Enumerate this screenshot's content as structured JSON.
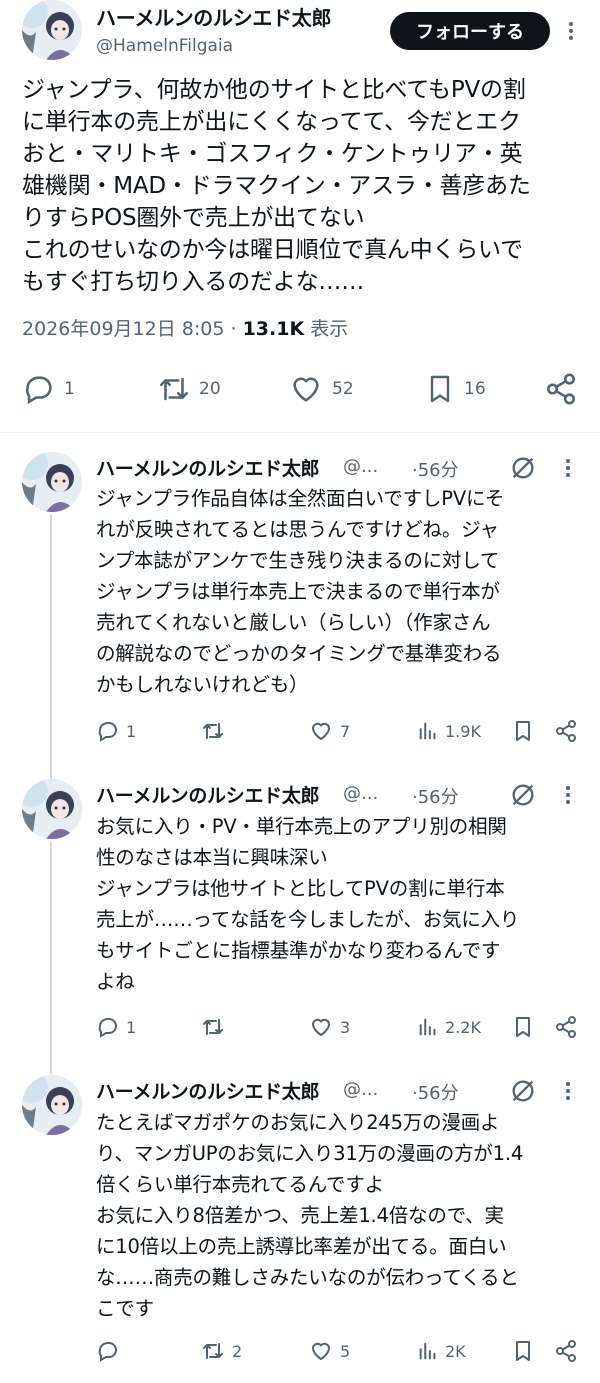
{
  "main_tweet": {
    "display_name": "ハーメルンのルシエド太郎",
    "handle": "@HamelnFilgaia",
    "follow_label": "フォローする",
    "text_lines": [
      "ジャンプラ、何故か他のサイトと比べてもPVの割",
      "に単行本の売上が出にくくなってて、今だとエク",
      "おと・マリトキ・ゴスフィク・ケントゥリア・英",
      "雄機関・MAD・ドラマクイン・アスラ・善彦あた",
      "りすらPOS圏外で売上が出てない",
      "これのせいなのか今は曜日順位で真ん中くらいで",
      "もすぐ打ち切り入るのだよな……"
    ],
    "timestamp": "2026年09月12日 8:05",
    "separator": "·",
    "views": "13.1K",
    "views_label": "表示",
    "replies": "1",
    "retweets": "20",
    "likes": "52",
    "bookmarks": "16"
  },
  "replies": [
    {
      "display_name": "ハーメルンのルシエド太郎",
      "handle": "@...",
      "time": "·56分",
      "text_lines": [
        "ジャンプラ作品自体は全然面白いですしPVにそ",
        "れが反映されてるとは思うんですけどね。ジャ",
        "ンプ本誌がアンケで生き残り決まるのに対して",
        "ジャンプラは単行本売上で決まるので単行本が",
        "売れてくれないと厳しい（らしい）（作家さん",
        "の解説なのでどっかのタイミングで基準変わる",
        "かもしれないけれども）"
      ],
      "replies": "1",
      "retweets": "",
      "likes": "7",
      "views": "1.9K"
    },
    {
      "display_name": "ハーメルンのルシエド太郎",
      "handle": "@...",
      "time": "·56分",
      "text_lines": [
        "お気に入り・PV・単行本売上のアプリ別の相関",
        "性のなさは本当に興味深い",
        "ジャンプラは他サイトと比してPVの割に単行本",
        "売上が……ってな話を今しましたが、お気に入り",
        "もサイトごとに指標基準がかなり変わるんです",
        "よね"
      ],
      "replies": "1",
      "retweets": "",
      "likes": "3",
      "views": "2.2K"
    },
    {
      "display_name": "ハーメルンのルシエド太郎",
      "handle": "@...",
      "time": "·56分",
      "text_lines": [
        "たとえばマガポケのお気に入り245万の漫画よ",
        "り、マンガUPのお気に入り31万の漫画の方が1.4",
        "倍くらい単行本売れてるんですよ",
        "お気に入り8倍差かつ、売上差1.4倍なので、実",
        "に10倍以上の売上誘導比率差が出てる。面白い",
        "な……商売の難しさみたいなのが伝わってくると",
        "こです"
      ],
      "replies": "",
      "retweets": "2",
      "likes": "5",
      "views": "2K"
    }
  ],
  "icons": {
    "reply": "speech-bubble-icon",
    "retweet": "retweet-arrows-icon",
    "like": "heart-icon",
    "bookmark": "bookmark-icon",
    "share": "share-nodes-icon",
    "views": "bar-chart-icon",
    "grok": "slashed-circle-icon",
    "more": "vertical-dots-icon"
  },
  "colors": {
    "text": "#0f1419",
    "muted": "#536471",
    "follow_bg": "#0f1419",
    "divider": "#eff3f4"
  }
}
